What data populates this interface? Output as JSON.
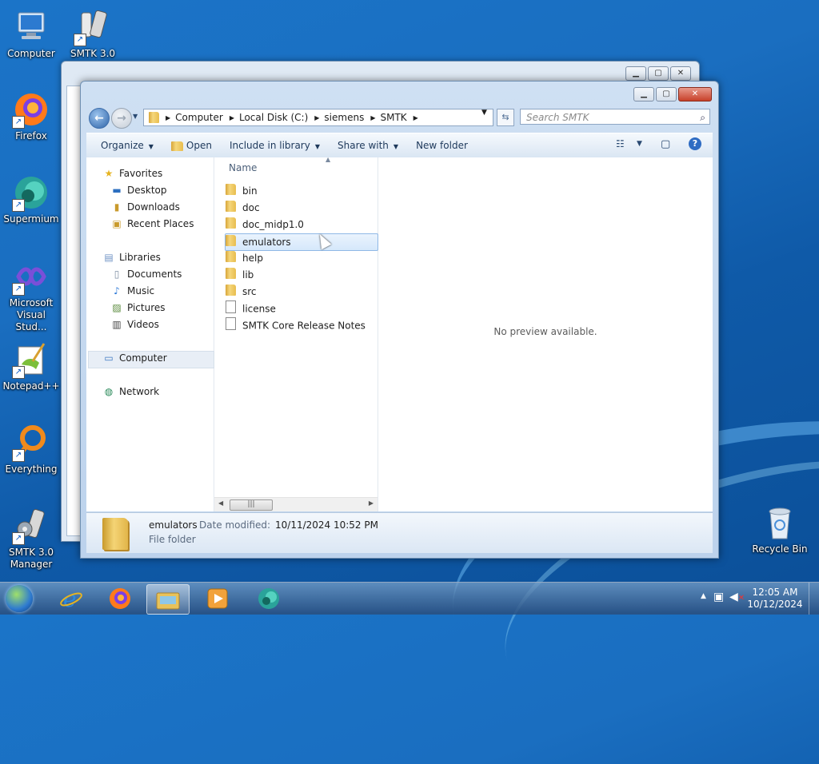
{
  "desktop": {
    "icons": [
      {
        "label": "Computer",
        "icon": "computer-icon"
      },
      {
        "label": "SMTK 3.0",
        "icon": "phone-icon"
      },
      {
        "label": "Firefox",
        "icon": "firefox-icon"
      },
      {
        "label": "Supermium",
        "icon": "supermium-icon"
      },
      {
        "label": "Microsoft Visual Stud...",
        "icon": "visual-studio-icon"
      },
      {
        "label": "Notepad++",
        "icon": "notepadpp-icon"
      },
      {
        "label": "Everything",
        "icon": "everything-icon"
      },
      {
        "label": "SMTK 3.0 Manager",
        "icon": "phone-manager-icon"
      },
      {
        "label": "Recycle Bin",
        "icon": "recycle-bin-icon"
      }
    ]
  },
  "explorer": {
    "address": [
      "Computer",
      "Local Disk (C:)",
      "siemens",
      "SMTK"
    ],
    "search_placeholder": "Search SMTK",
    "toolbar": {
      "organize": "Organize",
      "open": "Open",
      "include": "Include in library",
      "share": "Share with",
      "new_folder": "New folder"
    },
    "nav": {
      "favorites": "Favorites",
      "desktop": "Desktop",
      "downloads": "Downloads",
      "recent": "Recent Places",
      "libraries": "Libraries",
      "documents": "Documents",
      "music": "Music",
      "pictures": "Pictures",
      "videos": "Videos",
      "computer": "Computer",
      "network": "Network"
    },
    "column_name": "Name",
    "files": [
      {
        "name": "bin",
        "type": "folder"
      },
      {
        "name": "doc",
        "type": "folder"
      },
      {
        "name": "doc_midp1.0",
        "type": "folder"
      },
      {
        "name": "emulators",
        "type": "folder",
        "selected": true
      },
      {
        "name": "help",
        "type": "folder"
      },
      {
        "name": "lib",
        "type": "folder"
      },
      {
        "name": "src",
        "type": "folder"
      },
      {
        "name": "license",
        "type": "file"
      },
      {
        "name": "SMTK Core Release Notes",
        "type": "file"
      }
    ],
    "preview_text": "No preview available.",
    "details": {
      "name": "emulators",
      "modified_label": "Date modified:",
      "modified": "10/11/2024 10:52 PM",
      "type": "File folder"
    }
  },
  "taskbar": {
    "time": "12:05 AM",
    "date": "10/12/2024"
  }
}
